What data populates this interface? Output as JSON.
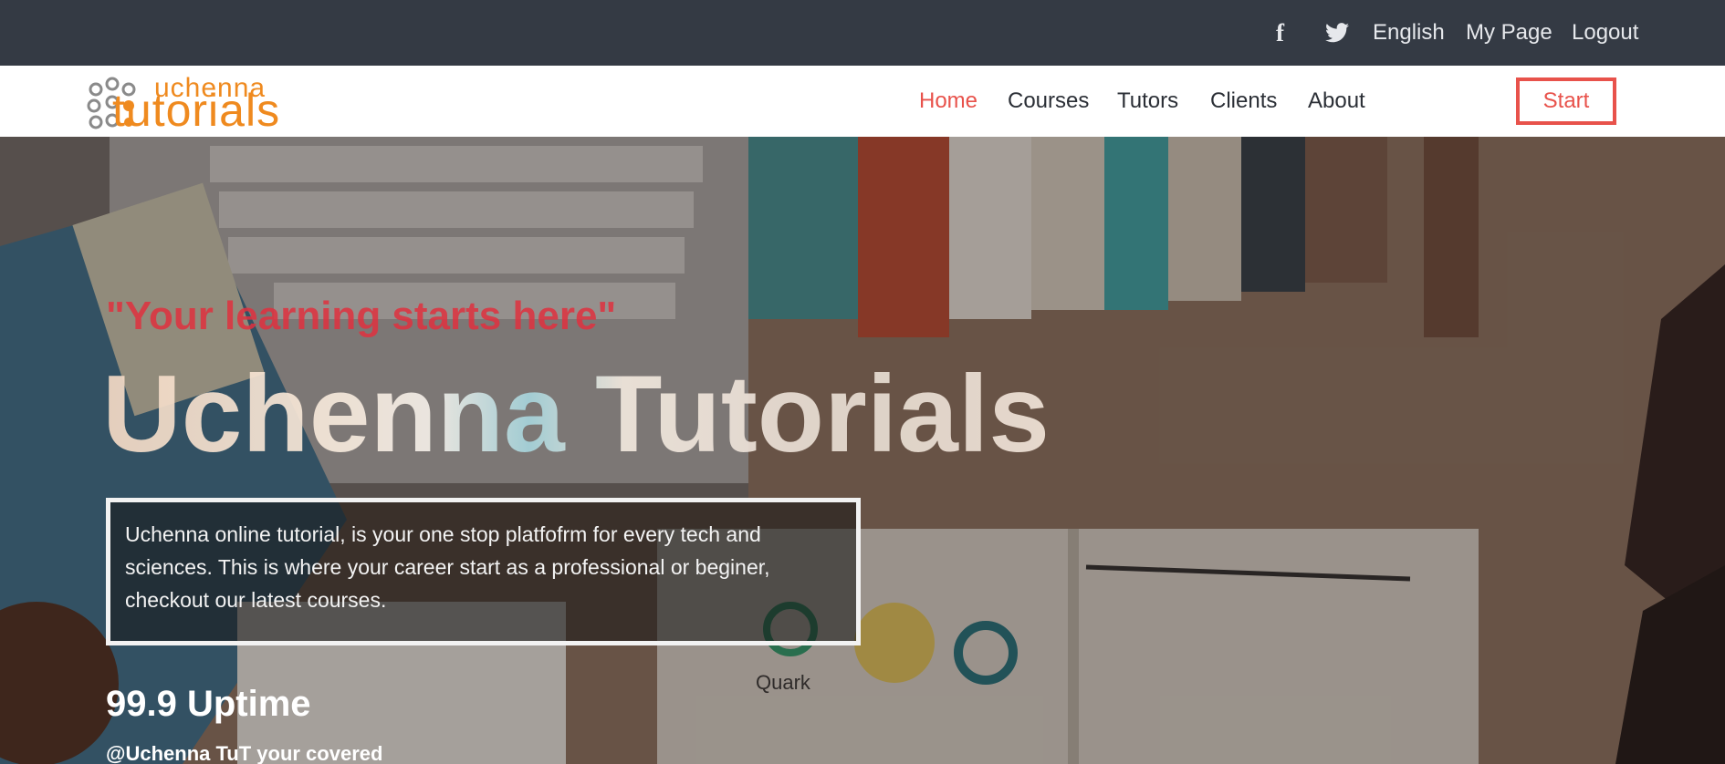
{
  "topbar": {
    "facebook_icon": "f",
    "language": "English",
    "my_page": "My Page",
    "logout": "Logout"
  },
  "logo": {
    "line1": "uchenna",
    "line2": "tutorials"
  },
  "nav": {
    "items": [
      "Home",
      "Courses",
      "Tutors",
      "Clients",
      "About"
    ],
    "active": "Home",
    "start": "Start"
  },
  "hero": {
    "tagline": "\"Your learning starts here\"",
    "title": "Uchenna Tutorials",
    "description": "Uchenna online tutorial, is your one stop platfofrm for every tech and sciences. This is where your career start as a professional or beginer, checkout our latest courses.",
    "stat": "99.9 Uptime",
    "subtext": "@Uchenna TuT your covered"
  },
  "colors": {
    "topbar_bg": "#343a44",
    "accent_red": "#e8524b",
    "logo_orange": "#ef8a1f"
  },
  "icons": [
    "facebook-icon",
    "twitter-icon",
    "logo-dots-icon"
  ]
}
